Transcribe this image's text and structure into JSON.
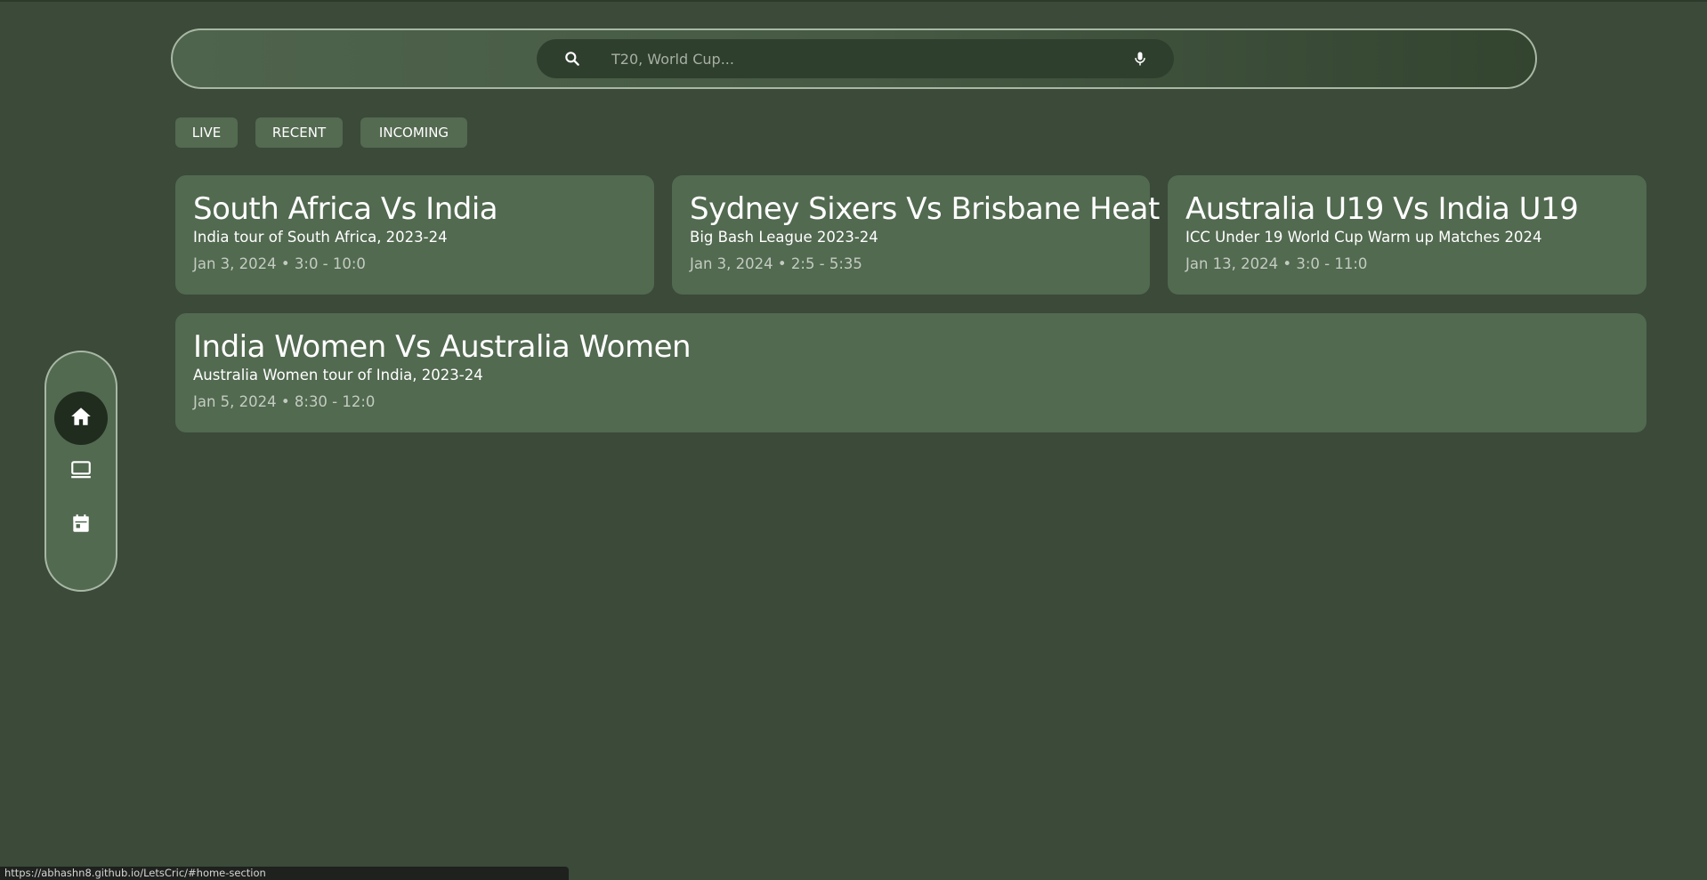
{
  "search": {
    "placeholder": "T20, World Cup..."
  },
  "tabs": [
    {
      "label": "LIVE"
    },
    {
      "label": "RECENT"
    },
    {
      "label": "INCOMING"
    }
  ],
  "matches": [
    {
      "title": "South Africa Vs India",
      "series": "India tour of South Africa, 2023-24",
      "time": "Jan 3, 2024 • 3:0 - 10:0"
    },
    {
      "title": "Sydney Sixers Vs Brisbane Heat",
      "series": "Big Bash League 2023-24",
      "time": "Jan 3, 2024 • 2:5 - 5:35"
    },
    {
      "title": "Australia U19 Vs India U19",
      "series": "ICC Under 19 World Cup Warm up Matches 2024",
      "time": "Jan 13, 2024 • 3:0 - 11:0"
    },
    {
      "title": "India Women Vs Australia Women",
      "series": "Australia Women tour of India, 2023-24",
      "time": "Jan 5, 2024 • 8:30 - 12:0"
    }
  ],
  "side_nav": {
    "items": [
      {
        "icon": "home-icon",
        "active": true
      },
      {
        "icon": "monitor-icon",
        "active": false
      },
      {
        "icon": "calendar-icon",
        "active": false
      }
    ]
  },
  "status_bar": {
    "url": "https://abhashn8.github.io/LetsCric/#home-section"
  },
  "colors": {
    "background": "#3b4a39",
    "card": "#526a50",
    "tab": "#546a51",
    "search_pill": "#2f3f2e",
    "nav_active": "#1f2c1e",
    "border": "#a8b8a4"
  }
}
